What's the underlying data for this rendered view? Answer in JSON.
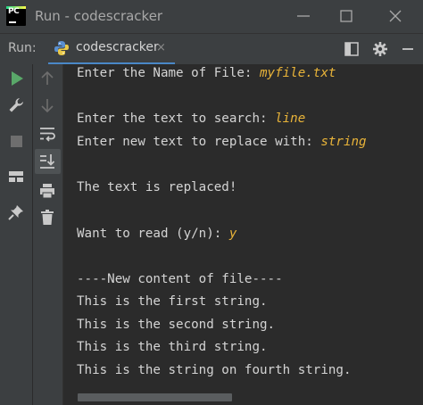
{
  "window": {
    "title": "Run - codescracker"
  },
  "toolbar": {
    "run_label": "Run:",
    "tab_label": "codescracker",
    "tab_close": "×"
  },
  "icons": {
    "app": "pycharm-logo",
    "minimize": "minimize-icon",
    "maximize": "maximize-icon",
    "close": "close-icon",
    "layout": "layout-icon",
    "settings": "gear-icon",
    "hide": "minus-icon",
    "run": "run-icon",
    "wrench": "wrench-icon",
    "stop": "stop-icon",
    "layout2": "layout-grid-icon",
    "pin": "pin-icon",
    "up": "arrow-up-icon",
    "down": "arrow-down-icon",
    "wrap": "soft-wrap-icon",
    "scroll_end": "scroll-to-end-icon",
    "print": "print-icon",
    "trash": "trash-icon"
  },
  "console": {
    "lines": [
      {
        "prompt": "Enter the Name of File: ",
        "input": "myfile.txt"
      },
      {
        "prompt": "",
        "input": ""
      },
      {
        "prompt": "Enter the text to search: ",
        "input": "line"
      },
      {
        "prompt": "Enter new text to replace with: ",
        "input": "string"
      },
      {
        "prompt": "",
        "input": ""
      },
      {
        "prompt": "The text is replaced!",
        "input": ""
      },
      {
        "prompt": "",
        "input": ""
      },
      {
        "prompt": "Want to read (y/n): ",
        "input": "y"
      },
      {
        "prompt": "",
        "input": ""
      },
      {
        "prompt": "----New content of file----",
        "input": ""
      },
      {
        "prompt": "This is the first string.",
        "input": ""
      },
      {
        "prompt": "This is the second string.",
        "input": ""
      },
      {
        "prompt": "This is the third string.",
        "input": ""
      },
      {
        "prompt": "This is the string on fourth string.",
        "input": ""
      }
    ]
  },
  "colors": {
    "background": "#2b2b2b",
    "panel": "#3c3f41",
    "text": "#d4d4d4",
    "user_input": "#e8b339",
    "run_green": "#59a869",
    "tab_underline": "#4a88c7"
  }
}
